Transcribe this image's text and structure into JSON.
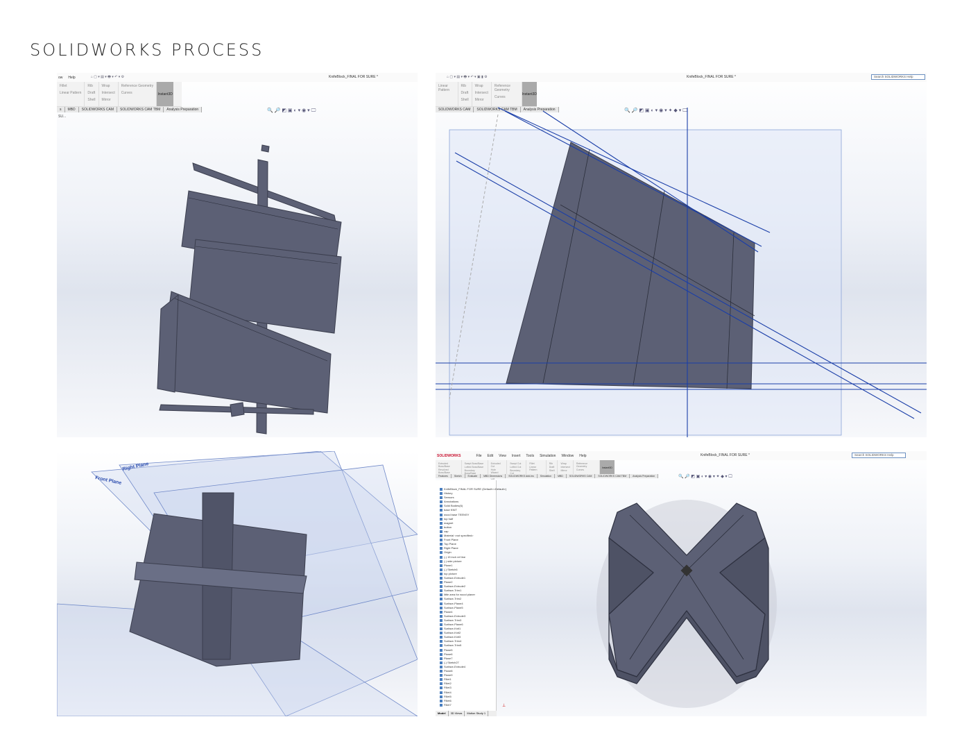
{
  "page_title": "SOLIDWORKS PROCESS",
  "document_title": "KnifeBlock_FINAL FOR SURE *",
  "menu": [
    "File",
    "Edit",
    "View",
    "Insert",
    "Tools",
    "Simulation",
    "Window",
    "Help"
  ],
  "menu_partial": [
    "ow",
    "Help"
  ],
  "brand": "SOLIDWORKS",
  "search_placeholder": "Search SOLIDWORKS Help",
  "ribbon": {
    "extruded_boss": "Extruded Boss/Base",
    "revolved_boss": "Revolved Boss/Base",
    "swept_boss": "Swept Boss/Base",
    "lofted_boss": "Lofted Boss/Base",
    "boundary_boss": "Boundary Boss/Base",
    "extruded_cut": "Extruded Cut",
    "hole_wizard": "Hole Wizard",
    "revolved_cut": "Revolved Cut",
    "swept_cut": "Swept Cut",
    "lofted_cut": "Lofted Cut",
    "boundary_cut": "Boundary Cut",
    "fillet": "Fillet",
    "linear_pattern": "Linear Pattern",
    "rib": "Rib",
    "draft": "Draft",
    "shell": "Shell",
    "wrap": "Wrap",
    "intersect": "Intersect",
    "mirror": "Mirror",
    "reference_geometry": "Reference Geometry",
    "curves": "Curves",
    "instant3d": "Instant3D"
  },
  "tabs_full": [
    "Features",
    "Sketch",
    "Evaluate",
    "MBD Dimensions",
    "SOLIDWORKS Add-Ins",
    "Simulation",
    "MBD",
    "SOLIDWORKS CAM",
    "SOLIDWORKS CAM TBM",
    "Analysis Preparation"
  ],
  "tabs_p1": [
    "s",
    "MBD",
    "SOLIDWORKS CAM",
    "SOLIDWORKS CAM TBM",
    "Analysis Preparation"
  ],
  "tabs_p2": [
    "SOLIDWORKS CAM",
    "SOLIDWORKS CAM TBM",
    "Analysis Preparation"
  ],
  "p1_breadcrumb": "SU...",
  "planes": {
    "front": "Front Plane",
    "right": "Right Plane"
  },
  "tree": [
    "KnifeBlock_FINAL FOR SURE (Default<<Default>)",
    "History",
    "Sensors",
    "Annotations",
    "Solid Bodies(6)",
    "base KNIT",
    "wood base TEENSY",
    "top half",
    "magnet",
    "button",
    "cap",
    "Material <not specified>",
    "Front Plane",
    "Top Plane",
    "Right Plane",
    "Origin",
    "(-) 15 inch ref line",
    "(-) side picture",
    "Plane1",
    "(-) Sketch6",
    "top picture",
    "Surface-Extrude1",
    "Plane2",
    "Surface-Extrude2",
    "Surface-Trim1",
    "little area for wood planer",
    "Surface-Trim2",
    "Surface-Plane4",
    "Surface-Plane5",
    "Plane4",
    "Surface-Extrude3",
    "Surface-Trim3",
    "Surface-Plane6",
    "Surface-Knit1",
    "Surface-Knit2",
    "Surface-Knit3",
    "Surface-Trim4",
    "Surface-Trim5",
    "Plane5",
    "Plane6",
    "Plane7",
    "(-) Sketch27",
    "Surface-Extrude4",
    "Plane8",
    "Plane9",
    "Fillet1",
    "Fillet2",
    "Fillet3",
    "Fillet4",
    "Fillet5",
    "Fillet6",
    "Fillet7"
  ],
  "bottom_tabs": [
    "Model",
    "3D Views",
    "Motion Study 1"
  ],
  "colors": {
    "body": "#5c6075",
    "edge": "#3a3d4d",
    "plane": "#1a3ea8",
    "accent": "#c8102e"
  }
}
